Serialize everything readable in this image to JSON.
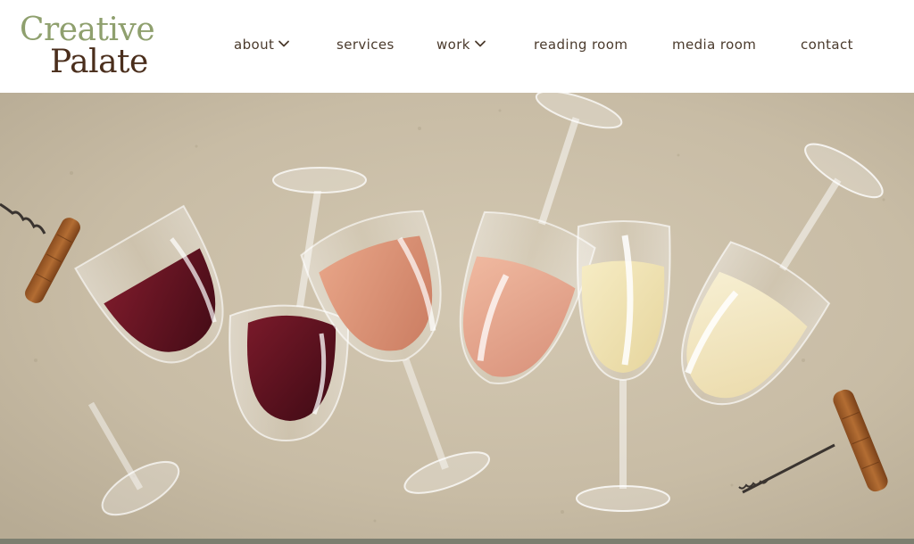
{
  "brand": {
    "line1": "Creative",
    "line2": "Palate",
    "line1_color": "#8fa06e",
    "line2_color": "#4a2e1c"
  },
  "nav": {
    "items": [
      {
        "label": "about",
        "has_dropdown": true,
        "icon": "chevron-down-icon"
      },
      {
        "label": "services",
        "has_dropdown": false
      },
      {
        "label": "work",
        "has_dropdown": true,
        "icon": "chevron-down-icon"
      },
      {
        "label": "reading room",
        "has_dropdown": false
      },
      {
        "label": "media room",
        "has_dropdown": false
      },
      {
        "label": "contact",
        "has_dropdown": false
      }
    ],
    "text_color": "#4a3a2c"
  },
  "hero": {
    "background_color": "#c9bda6",
    "band_color": "#7d7f70"
  }
}
